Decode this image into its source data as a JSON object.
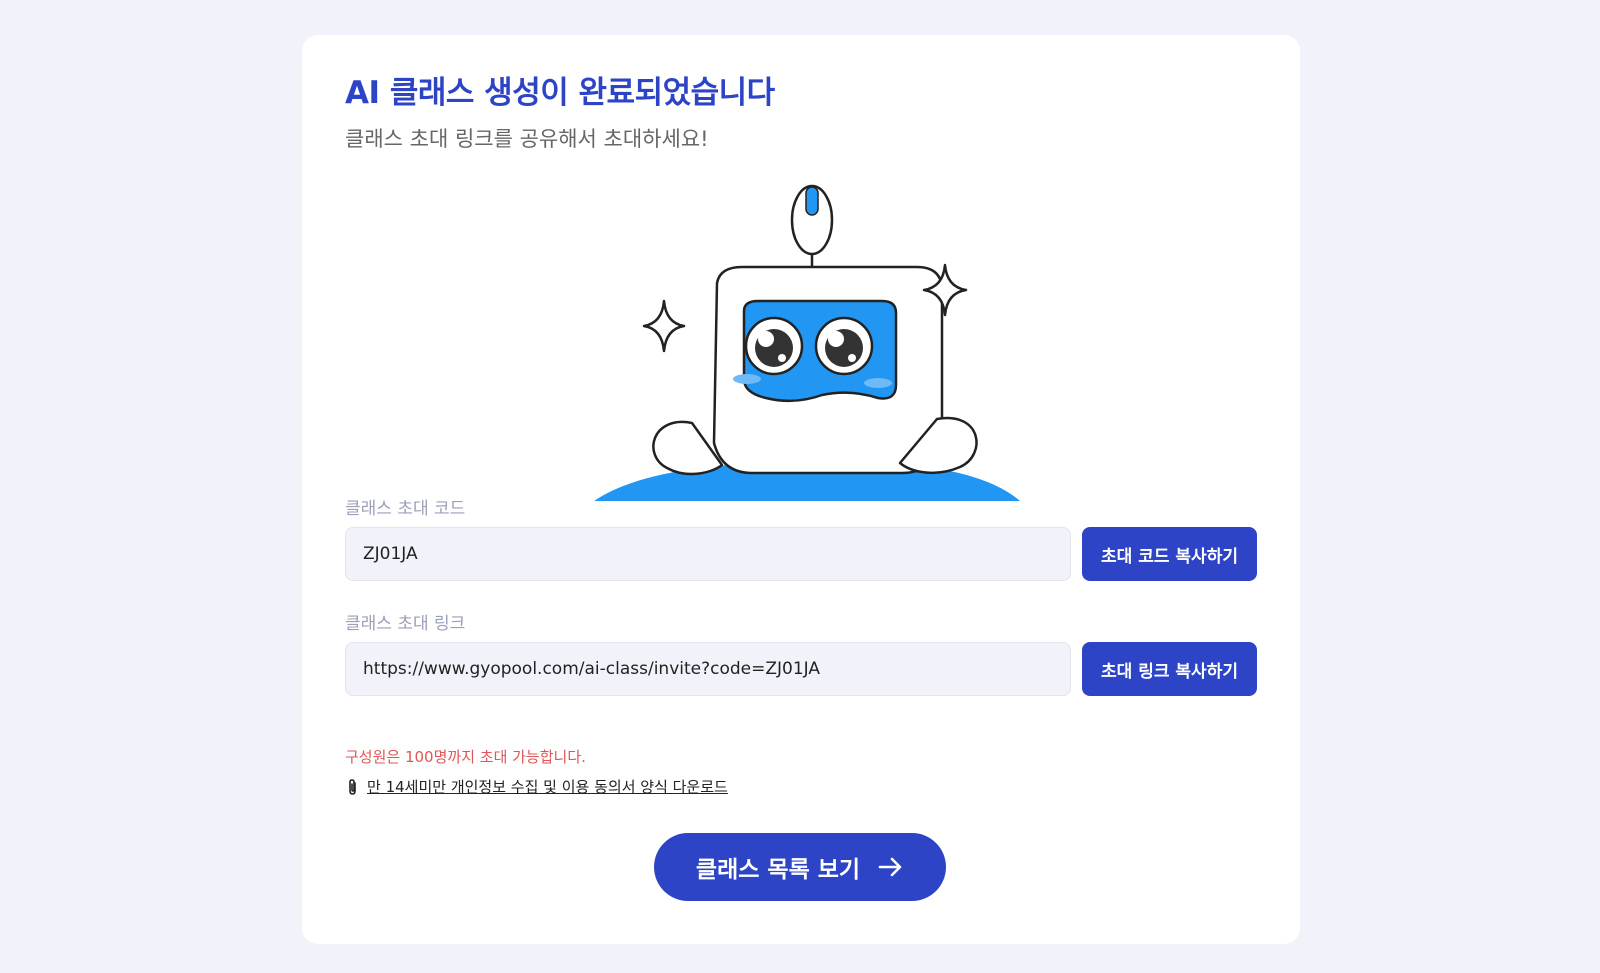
{
  "header": {
    "title": "AI 클래스 생성이 완료되었습니다",
    "subtitle": "클래스 초대 링크를 공유해서 초대하세요!"
  },
  "illustration": {
    "icon": "robot-mascot-illustration"
  },
  "invite_code": {
    "label": "클래스 초대 코드",
    "value": "ZJ01JA",
    "copy_button": "초대 코드 복사하기"
  },
  "invite_link": {
    "label": "클래스 초대 링크",
    "value": "https://www.gyopool.com/ai-class/invite?code=ZJ01JA",
    "copy_button": "초대 링크 복사하기"
  },
  "notice": "구성원은 100명까지 초대 가능합니다.",
  "download": {
    "icon": "paperclip-icon",
    "label": "만 14세미만 개인정보 수집 및 이용 동의서 양식 다운로드"
  },
  "footer": {
    "list_button": "클래스 목록 보기",
    "icon": "arrow-right-icon"
  },
  "colors": {
    "accent": "#2d44c7",
    "background": "#f2f3fa",
    "notice": "#e05555",
    "robot_screen": "#2196f3"
  }
}
